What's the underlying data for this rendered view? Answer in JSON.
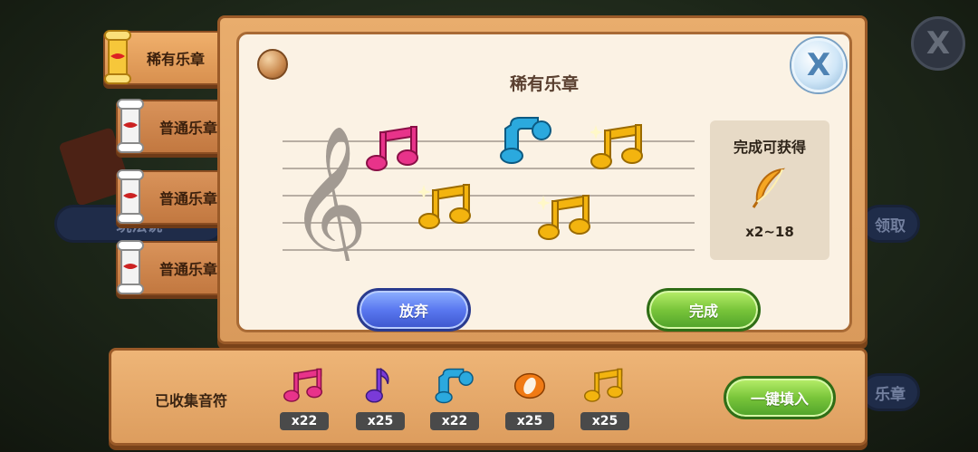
{
  "background": {
    "left_pill": "玩法说",
    "right_pill_1": "领取",
    "right_pill_2": "乐章",
    "close_symbol": "X"
  },
  "tabs": [
    {
      "label": "稀有乐章",
      "active": true,
      "icon": "golden-scroll-icon"
    },
    {
      "label": "普通乐章",
      "active": false,
      "icon": "white-scroll-icon"
    },
    {
      "label": "普通乐章",
      "active": false,
      "icon": "white-scroll-icon"
    },
    {
      "label": "普通乐章",
      "active": false,
      "icon": "white-scroll-icon"
    }
  ],
  "panel": {
    "title": "稀有乐章",
    "close_symbol": "X",
    "reward": {
      "title": "完成可获得",
      "icon": "feather-icon",
      "count": "x2~18"
    },
    "abandon_label": "放弃",
    "complete_label": "完成"
  },
  "staff_notes": [
    {
      "icon": "pink-beamed-note",
      "color": "#e8338a"
    },
    {
      "icon": "blue-eighth-note",
      "color": "#2ba9de"
    },
    {
      "icon": "gold-beamed-note",
      "color": "#f3b40f"
    },
    {
      "icon": "gold-beamed-note",
      "color": "#f3b40f"
    },
    {
      "icon": "gold-beamed-note",
      "color": "#f3b40f"
    }
  ],
  "collected": {
    "label": "已收集音符",
    "notes": [
      {
        "icon": "pink-beamed-note",
        "color": "#e8338a",
        "count": "x22"
      },
      {
        "icon": "purple-eighth-note",
        "color": "#7a3ad8",
        "count": "x25"
      },
      {
        "icon": "blue-eighth-note",
        "color": "#2ba9de",
        "count": "x22"
      },
      {
        "icon": "orange-whole-note",
        "color": "#f07a14",
        "count": "x25"
      },
      {
        "icon": "gold-beamed-note",
        "color": "#f3b40f",
        "count": "x25"
      }
    ],
    "fill_all_label": "一键填入"
  }
}
